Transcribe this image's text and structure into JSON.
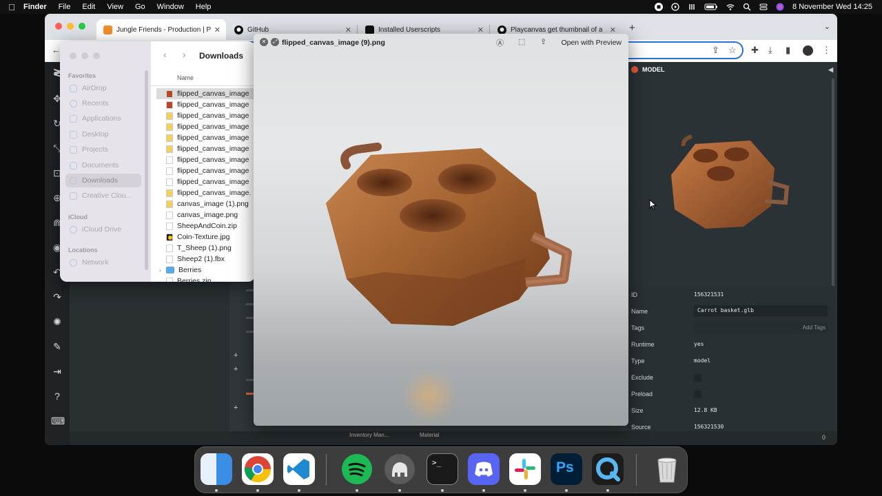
{
  "menubar": {
    "app_name": "Finder",
    "items": [
      "File",
      "Edit",
      "View",
      "Go",
      "Window",
      "Help"
    ],
    "datetime": "8 November Wed  14:25"
  },
  "browser": {
    "tabs": [
      {
        "title": "Jungle Friends - Production | P",
        "favicon_color": "#f28c28"
      },
      {
        "title": "GitHub",
        "favicon_color": "#111111"
      },
      {
        "title": "Installed Userscripts",
        "favicon_color": "#111111"
      },
      {
        "title": "Playcanvas get thumbnail of a",
        "favicon_color": "#111111"
      }
    ],
    "new_tab": "+"
  },
  "finder": {
    "title": "Downloads",
    "sections": [
      {
        "label": "Favorites",
        "items": [
          {
            "label": "AirDrop",
            "icon": "airdrop-icon"
          },
          {
            "label": "Recents",
            "icon": "clock-icon"
          },
          {
            "label": "Applications",
            "icon": "applications-icon"
          },
          {
            "label": "Desktop",
            "icon": "desktop-icon"
          },
          {
            "label": "Projects",
            "icon": "folder-icon"
          },
          {
            "label": "Documents",
            "icon": "document-icon"
          },
          {
            "label": "Downloads",
            "icon": "download-icon"
          },
          {
            "label": "Creative Clou...",
            "icon": "file-icon"
          }
        ]
      },
      {
        "label": "iCloud",
        "items": [
          {
            "label": "iCloud Drive",
            "icon": "cloud-icon"
          }
        ]
      },
      {
        "label": "Locations",
        "items": [
          {
            "label": "Network",
            "icon": "globe-icon"
          }
        ]
      }
    ],
    "column_header": "Name",
    "files": [
      {
        "name": "flipped_canvas_image",
        "icon": "red"
      },
      {
        "name": "flipped_canvas_image",
        "icon": "red"
      },
      {
        "name": "flipped_canvas_image",
        "icon": "yel"
      },
      {
        "name": "flipped_canvas_image",
        "icon": "yel"
      },
      {
        "name": "flipped_canvas_image",
        "icon": "yel"
      },
      {
        "name": "flipped_canvas_image",
        "icon": "yel"
      },
      {
        "name": "flipped_canvas_image",
        "icon": "plain"
      },
      {
        "name": "flipped_canvas_image",
        "icon": "plain"
      },
      {
        "name": "flipped_canvas_image",
        "icon": "plain"
      },
      {
        "name": "flipped_canvas_image.",
        "icon": "yel"
      },
      {
        "name": "canvas_image (1).png",
        "icon": "yel"
      },
      {
        "name": "canvas_image.png",
        "icon": "plain"
      },
      {
        "name": "SheepAndCoin.zip",
        "icon": "plain"
      },
      {
        "name": "Coin-Texture.jpg",
        "icon": "coin"
      },
      {
        "name": "T_Sheep (1).png",
        "icon": "plain"
      },
      {
        "name": "Sheep2 (1).fbx",
        "icon": "plain"
      },
      {
        "name": "Berries",
        "icon": "folder"
      },
      {
        "name": "Berries.zip",
        "icon": "plain"
      }
    ]
  },
  "quicklook": {
    "title": "flipped_canvas_image (9).png",
    "open_button": "Open with Preview"
  },
  "inspector": {
    "header": "MODEL",
    "properties": [
      {
        "key": "ID",
        "value": "156321531",
        "kind": "text"
      },
      {
        "key": "Name",
        "value": "Carrot basket.glb",
        "kind": "field"
      },
      {
        "key": "Tags",
        "value": "Add Tags",
        "kind": "tags"
      },
      {
        "key": "Runtime",
        "value": "yes",
        "kind": "text"
      },
      {
        "key": "Type",
        "value": "model",
        "kind": "text"
      },
      {
        "key": "Exclude",
        "value": "",
        "kind": "check"
      },
      {
        "key": "Preload",
        "value": "",
        "kind": "check"
      },
      {
        "key": "Size",
        "value": "12.8 KB",
        "kind": "text"
      },
      {
        "key": "Source",
        "value": "156321530",
        "kind": "text"
      }
    ]
  },
  "editor": {
    "bottom_labels": [
      "Inventory Man...",
      "Material"
    ],
    "status_count": "0"
  },
  "dock": {
    "apps": [
      {
        "name": "Finder",
        "color": "#4aa3f0",
        "icon": "finder-icon"
      },
      {
        "name": "Google Chrome",
        "color": "#ffffff",
        "icon": "chrome-icon"
      },
      {
        "name": "Visual Studio Code",
        "color": "#ffffff",
        "icon": "vscode-icon"
      },
      {
        "name": "Spotify",
        "color": "#1db954",
        "icon": "spotify-icon"
      },
      {
        "name": "TablePlus",
        "color": "#5a5a5a",
        "icon": "elephant-icon"
      },
      {
        "name": "Terminal",
        "color": "#1a1a1a",
        "icon": "terminal-icon"
      },
      {
        "name": "Discord",
        "color": "#5865f2",
        "icon": "discord-icon"
      },
      {
        "name": "Slack",
        "color": "#ffffff",
        "icon": "slack-icon"
      },
      {
        "name": "Photoshop",
        "color": "#001e36",
        "icon": "photoshop-icon"
      },
      {
        "name": "QuickTime Player",
        "color": "#1c1c1c",
        "icon": "quicktime-icon"
      },
      {
        "name": "Trash",
        "color": "#d8d8d8",
        "icon": "trash-icon"
      }
    ]
  }
}
